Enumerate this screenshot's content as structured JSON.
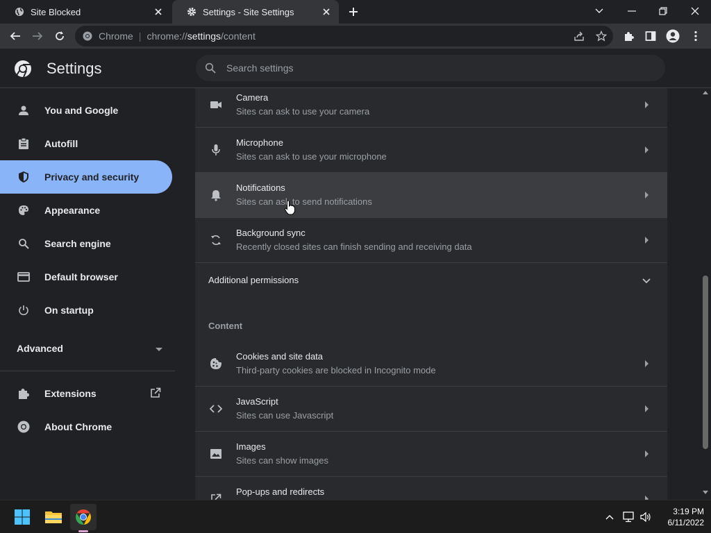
{
  "browser": {
    "tabs": [
      {
        "title": "Site Blocked",
        "active": false
      },
      {
        "title": "Settings - Site Settings",
        "active": true
      }
    ],
    "omnibox": {
      "chip": "Chrome",
      "url_scheme": "chrome://",
      "url_host": "settings",
      "url_path": "/content"
    }
  },
  "settings": {
    "title": "Settings",
    "search_placeholder": "Search settings"
  },
  "sidebar": {
    "items": [
      {
        "label": "You and Google",
        "icon": "person-icon"
      },
      {
        "label": "Autofill",
        "icon": "clipboard-icon"
      },
      {
        "label": "Privacy and security",
        "icon": "shield-icon",
        "selected": true
      },
      {
        "label": "Appearance",
        "icon": "palette-icon"
      },
      {
        "label": "Search engine",
        "icon": "search-icon"
      },
      {
        "label": "Default browser",
        "icon": "browser-window-icon"
      },
      {
        "label": "On startup",
        "icon": "power-icon"
      }
    ],
    "advanced": "Advanced",
    "extensions": "Extensions",
    "about": "About Chrome"
  },
  "main": {
    "permissions": [
      {
        "title": "Camera",
        "subtitle": "Sites can ask to use your camera",
        "icon": "camera-icon"
      },
      {
        "title": "Microphone",
        "subtitle": "Sites can ask to use your microphone",
        "icon": "microphone-icon"
      },
      {
        "title": "Notifications",
        "subtitle": "Sites can ask to send notifications",
        "icon": "bell-icon"
      },
      {
        "title": "Background sync",
        "subtitle": "Recently closed sites can finish sending and receiving data",
        "icon": "sync-icon"
      }
    ],
    "additional_permissions": "Additional permissions",
    "content_title": "Content",
    "content": [
      {
        "title": "Cookies and site data",
        "subtitle": "Third-party cookies are blocked in Incognito mode",
        "icon": "cookie-icon"
      },
      {
        "title": "JavaScript",
        "subtitle": "Sites can use Javascript",
        "icon": "code-icon"
      },
      {
        "title": "Images",
        "subtitle": "Sites can show images",
        "icon": "image-icon"
      },
      {
        "title": "Pop-ups and redirects",
        "subtitle": "",
        "icon": "popup-icon"
      }
    ]
  },
  "taskbar": {
    "time": "3:19 PM",
    "date": "6/11/2022"
  },
  "colors": {
    "accent": "#8ab4f8",
    "background": "#202124",
    "card": "#292a2d",
    "toolbar": "#35363a"
  }
}
